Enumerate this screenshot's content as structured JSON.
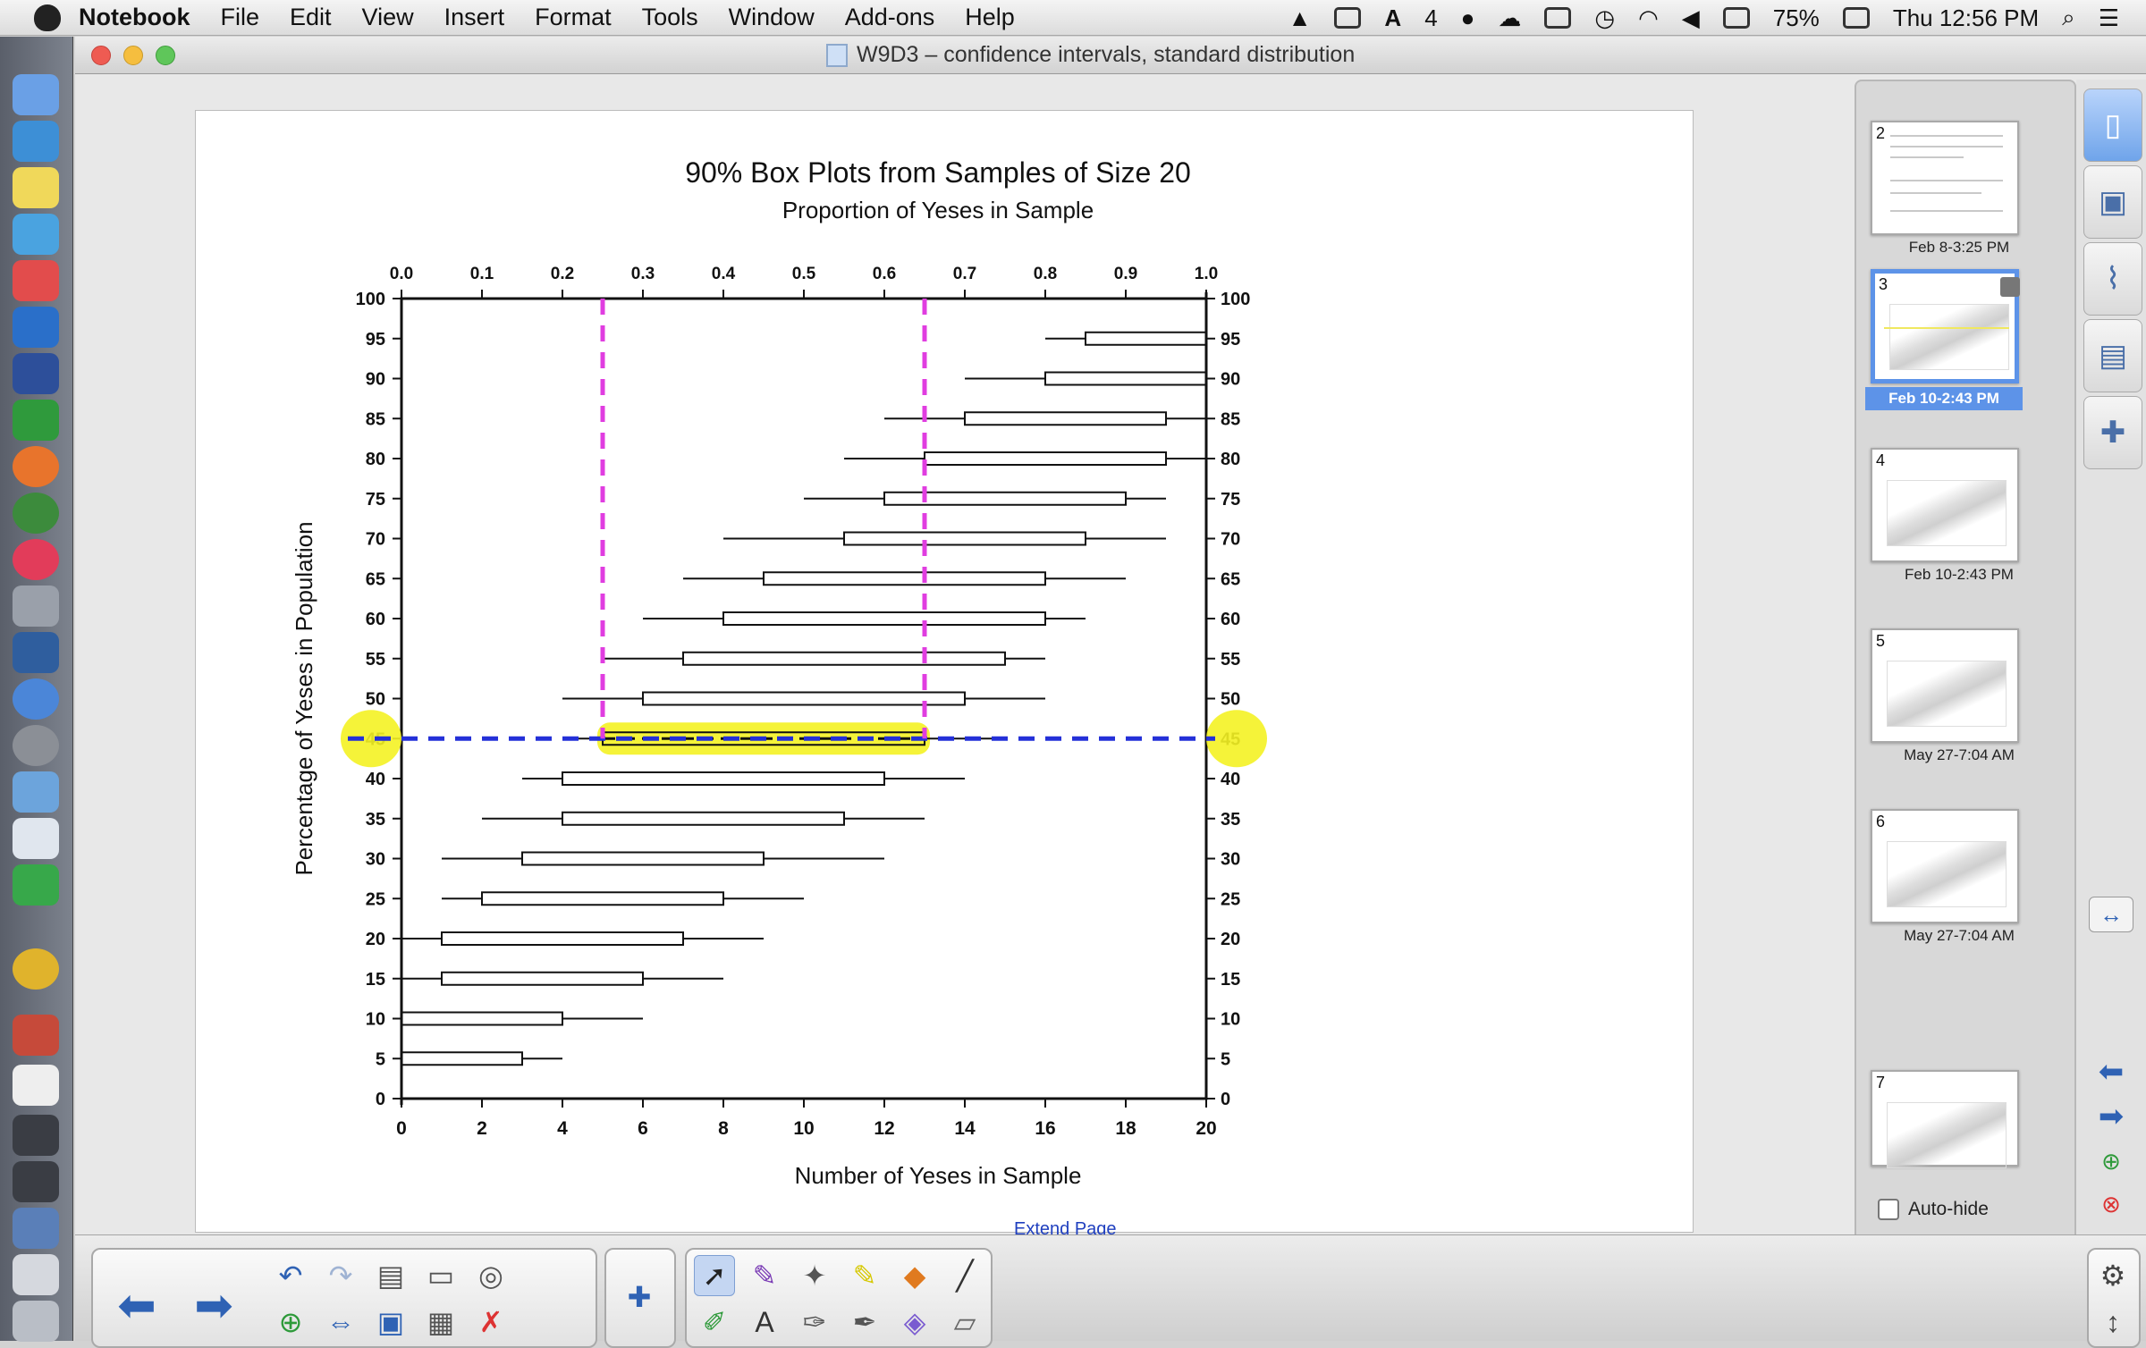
{
  "menubar": {
    "app_name": "Notebook",
    "items": [
      "File",
      "Edit",
      "View",
      "Insert",
      "Format",
      "Tools",
      "Window",
      "Add-ons",
      "Help"
    ],
    "status": {
      "badge_count": "4",
      "battery": "75%",
      "clock": "Thu 12:56 PM"
    }
  },
  "window": {
    "title": "W9D3 – confidence intervals, standard distribution"
  },
  "page": {
    "extend_link": "Extend Page"
  },
  "chart_data": {
    "type": "box",
    "title": "90% Box Plots from Samples of Size 20",
    "top_axis_label": "Proportion of Yeses in Sample",
    "top_ticks": [
      "0.0",
      "0.1",
      "0.2",
      "0.3",
      "0.4",
      "0.5",
      "0.6",
      "0.7",
      "0.8",
      "0.9",
      "1.0"
    ],
    "xlabel": "Number of Yeses in Sample",
    "x_ticks": [
      "0",
      "2",
      "4",
      "6",
      "8",
      "10",
      "12",
      "14",
      "16",
      "18",
      "20"
    ],
    "ylabel": "Percentage of Yeses in Population",
    "y_ticks": [
      "0",
      "5",
      "10",
      "15",
      "20",
      "25",
      "30",
      "35",
      "40",
      "45",
      "50",
      "55",
      "60",
      "65",
      "70",
      "75",
      "80",
      "85",
      "90",
      "95",
      "100"
    ],
    "xlim": [
      0,
      20
    ],
    "ylim": [
      0,
      100
    ],
    "boxes": [
      {
        "p": 0,
        "w_lo": 0,
        "q1": 0,
        "q3": 0,
        "w_hi": 0
      },
      {
        "p": 5,
        "w_lo": 0,
        "q1": 0,
        "q3": 3,
        "w_hi": 4
      },
      {
        "p": 10,
        "w_lo": 0,
        "q1": 0,
        "q3": 4,
        "w_hi": 6
      },
      {
        "p": 15,
        "w_lo": 0,
        "q1": 1,
        "q3": 6,
        "w_hi": 8
      },
      {
        "p": 20,
        "w_lo": 0,
        "q1": 1,
        "q3": 7,
        "w_hi": 9
      },
      {
        "p": 25,
        "w_lo": 1,
        "q1": 2,
        "q3": 8,
        "w_hi": 10
      },
      {
        "p": 30,
        "w_lo": 1,
        "q1": 3,
        "q3": 9,
        "w_hi": 12
      },
      {
        "p": 35,
        "w_lo": 2,
        "q1": 4,
        "q3": 11,
        "w_hi": 13
      },
      {
        "p": 40,
        "w_lo": 3,
        "q1": 4,
        "q3": 12,
        "w_hi": 14
      },
      {
        "p": 45,
        "w_lo": 4,
        "q1": 5,
        "q3": 13,
        "w_hi": 15
      },
      {
        "p": 50,
        "w_lo": 4,
        "q1": 6,
        "q3": 14,
        "w_hi": 16
      },
      {
        "p": 55,
        "w_lo": 5,
        "q1": 7,
        "q3": 15,
        "w_hi": 16
      },
      {
        "p": 60,
        "w_lo": 6,
        "q1": 8,
        "q3": 16,
        "w_hi": 17
      },
      {
        "p": 65,
        "w_lo": 7,
        "q1": 9,
        "q3": 16,
        "w_hi": 18
      },
      {
        "p": 70,
        "w_lo": 8,
        "q1": 11,
        "q3": 17,
        "w_hi": 19
      },
      {
        "p": 75,
        "w_lo": 10,
        "q1": 12,
        "q3": 18,
        "w_hi": 19
      },
      {
        "p": 80,
        "w_lo": 11,
        "q1": 13,
        "q3": 19,
        "w_hi": 20
      },
      {
        "p": 85,
        "w_lo": 12,
        "q1": 14,
        "q3": 19,
        "w_hi": 20
      },
      {
        "p": 90,
        "w_lo": 14,
        "q1": 16,
        "q3": 20,
        "w_hi": 20
      },
      {
        "p": 95,
        "w_lo": 16,
        "q1": 17,
        "q3": 20,
        "w_hi": 20
      },
      {
        "p": 100,
        "w_lo": 20,
        "q1": 20,
        "q3": 20,
        "w_hi": 20
      }
    ],
    "annotations": {
      "horizontal_line_y": 45,
      "vertical_lines_x": [
        5,
        13
      ],
      "highlighted_box_p": 45,
      "colors": {
        "horizontal": "#2430d8",
        "vertical": "#e03de0",
        "highlight": "#f4f224"
      }
    }
  },
  "sorter": {
    "pages": [
      {
        "num": "2",
        "label": "Feb 8-3:25 PM",
        "selected": false
      },
      {
        "num": "3",
        "label": "Feb 10-2:43 PM",
        "selected": true
      },
      {
        "num": "4",
        "label": "Feb 10-2:43 PM",
        "selected": false
      },
      {
        "num": "5",
        "label": "May 27-7:04 AM",
        "selected": false
      },
      {
        "num": "6",
        "label": "May 27-7:04 AM",
        "selected": false
      },
      {
        "num": "7",
        "label": "",
        "selected": false
      }
    ],
    "autohide_label": "Auto-hide"
  }
}
